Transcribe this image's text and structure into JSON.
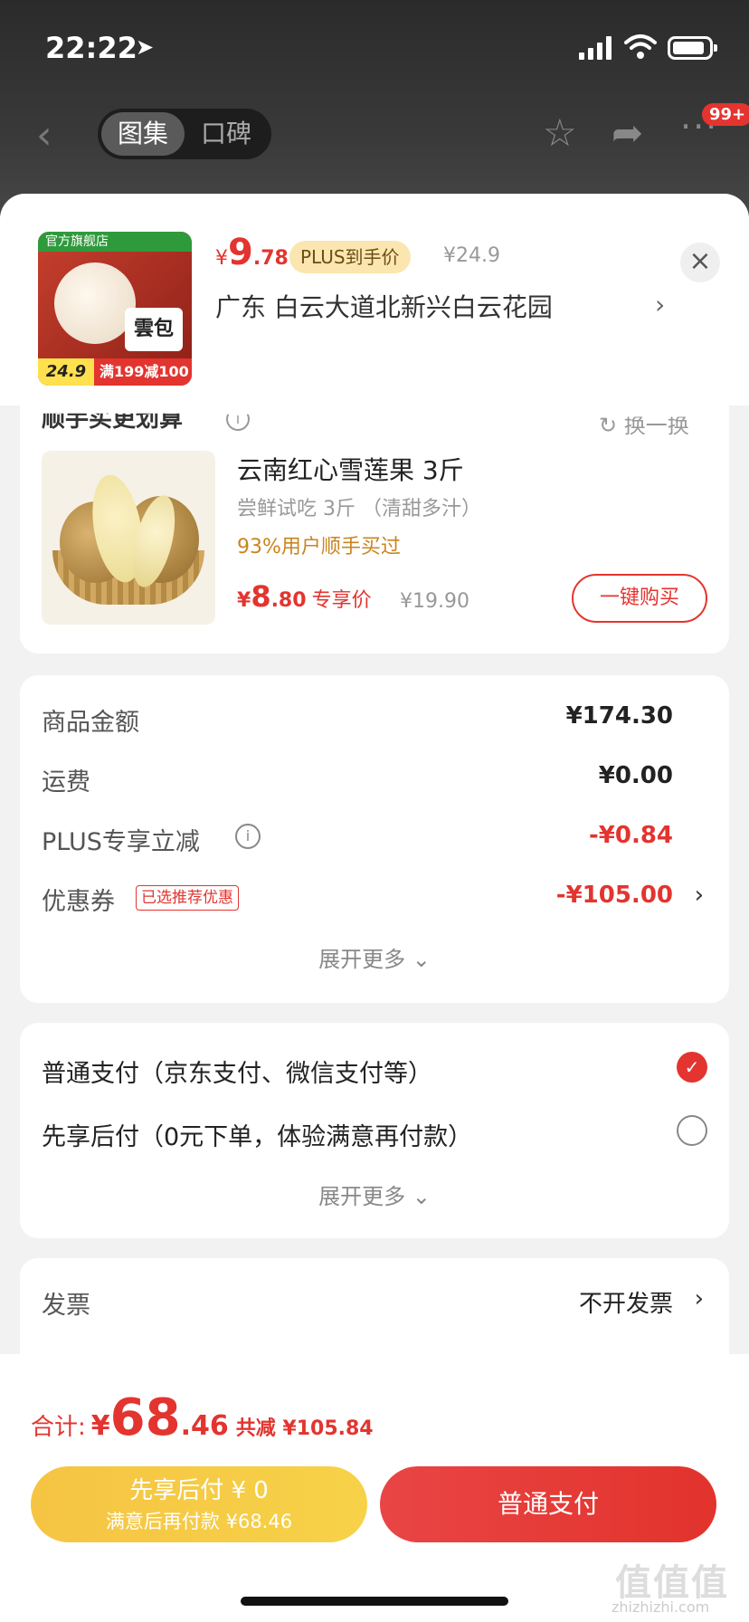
{
  "status": {
    "time": "22:22"
  },
  "nav": {
    "tab_gallery": "图集",
    "tab_reviews": "口碑",
    "badge": "99+"
  },
  "product": {
    "shop_tag": "官方旗舰店",
    "image_label": "雲包",
    "image_price": "24.9",
    "image_promo": "满199减100",
    "price_currency": "¥",
    "price_int": "9",
    "price_dec": ".78",
    "plus_tag": "PLUS到手价",
    "original_price": "¥24.9",
    "address": "广东  白云大道北新兴白云花园"
  },
  "upsell": {
    "title": "顺手买更划算",
    "refresh_label": "换一换",
    "item_name": "云南红心雪莲果 3斤",
    "item_sub": "尝鲜试吃 3斤 （清甜多汁）",
    "social_proof": "93%用户顺手买过",
    "price_currency": "¥",
    "price_int": "8",
    "price_dec": ".80",
    "price_label": "专享价",
    "original_price": "¥19.90",
    "buy_button": "一键购买"
  },
  "amounts": {
    "goods_label": "商品金额",
    "goods_value": "¥174.30",
    "shipping_label": "运费",
    "shipping_value": "¥0.00",
    "plus_label": "PLUS专享立减",
    "plus_value": "-¥0.84",
    "coupon_label": "优惠券",
    "coupon_tag": "已选推荐优惠",
    "coupon_value": "-¥105.00",
    "expand": "展开更多"
  },
  "payment": {
    "option_normal": "普通支付（京东支付、微信支付等）",
    "option_later": "先享后付（0元下单，体验满意再付款）",
    "expand": "展开更多"
  },
  "invoice": {
    "label": "发票",
    "value": "不开发票"
  },
  "bottom": {
    "total_label": "合计:",
    "total_currency": "¥",
    "total_int": "68",
    "total_dec": ".46",
    "saved": "共减 ¥105.84",
    "pay_later_line1": "先享后付 ¥ 0",
    "pay_later_line2": "满意后再付款 ¥68.46",
    "pay_button": "普通支付",
    "watermark": "值值值",
    "watermark_sub": "zhizhizhi.com"
  },
  "colors": {
    "accent_red": "#e3342f",
    "plus_gold": "#fbe6b0",
    "pay_later_yellow": "#f5c443"
  }
}
